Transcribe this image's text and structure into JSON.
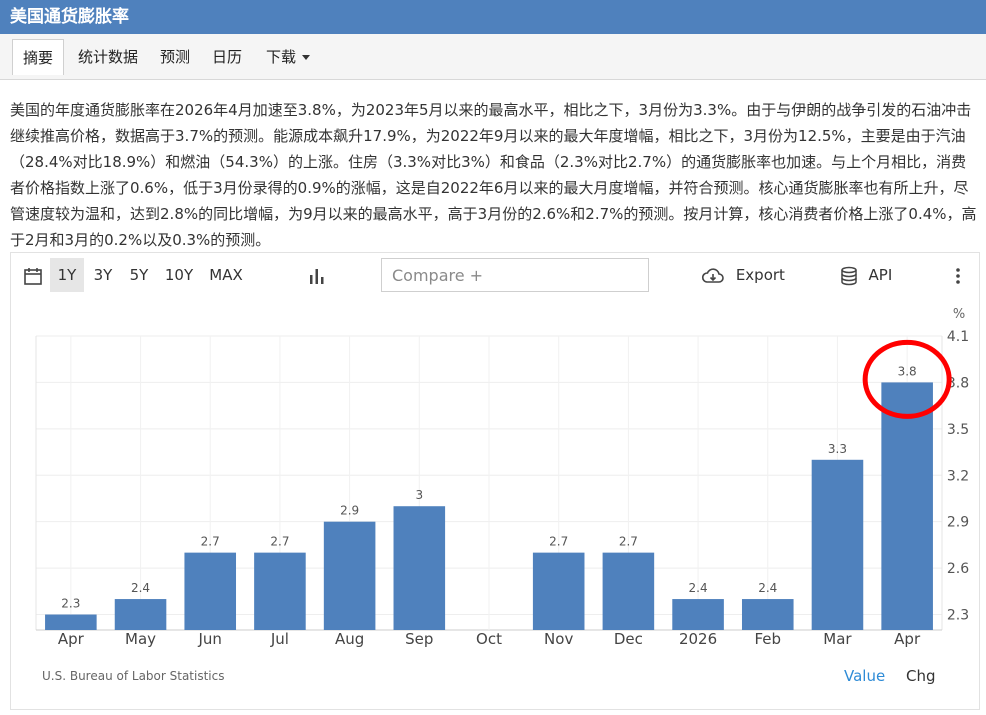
{
  "page": {
    "title": "美国通货膨胀率",
    "tabs": [
      {
        "label": "摘要"
      },
      {
        "label": "统计数据"
      },
      {
        "label": "预测"
      },
      {
        "label": "日历"
      },
      {
        "label": "下载"
      }
    ],
    "description": "美国的年度通货膨胀率在2026年4月加速至3.8%，为2023年5月以来的最高水平，相比之下，3月份为3.3%。由于与伊朗的战争引发的石油冲击继续推高价格，数据高于3.7%的预测。能源成本飙升17.9%，为2022年9月以来的最大年度增幅，相比之下，3月份为12.5%，主要是由于汽油（28.4%对比18.9%）和燃油（54.3%）的上涨。住房（3.3%对比3%）和食品（2.3%对比2.7%）的通货膨胀率也加速。与上个月相比，消费者价格指数上涨了0.6%，低于3月份录得的0.9%的涨幅，这是自2022年6月以来的最大月度增幅，并符合预测。核心通货膨胀率也有所上升，尽管速度较为温和，达到2.8%的同比增幅，为9月以来的最高水平，高于3月份的2.6%和2.7%的预测。按月计算，核心消费者价格上涨了0.4%，高于2月和3月的0.2%以及0.3%的预测。"
  },
  "toolbar": {
    "ranges": [
      "1Y",
      "3Y",
      "5Y",
      "10Y",
      "MAX"
    ],
    "selected_range": "1Y",
    "compare_placeholder": "Compare +",
    "export_label": "Export",
    "api_label": "API",
    "icons": [
      "calendar-icon",
      "bar-chart-icon",
      "cloud-download-icon",
      "database-icon",
      "more-vertical-icon"
    ]
  },
  "chart_data": {
    "type": "bar",
    "categories": [
      "Apr",
      "May",
      "Jun",
      "Jul",
      "Aug",
      "Sep",
      "Oct",
      "Nov",
      "Dec",
      "2026",
      "Feb",
      "Mar",
      "Apr"
    ],
    "values": [
      2.3,
      2.4,
      2.7,
      2.7,
      2.9,
      3,
      null,
      2.7,
      2.7,
      2.4,
      2.4,
      3.3,
      3.8
    ],
    "data_labels": [
      "2.3",
      "2.4",
      "2.7",
      "2.7",
      "2.9",
      "3",
      "",
      "2.7",
      "2.7",
      "2.4",
      "2.4",
      "3.3",
      "3.8"
    ],
    "y_unit": "%",
    "y_ticks": [
      "4.1",
      "3.8",
      "3.5",
      "3.2",
      "2.9",
      "2.6",
      "2.3"
    ],
    "ylim": [
      2.2,
      4.1
    ],
    "grid": true,
    "bar_color": "#4f81bd",
    "highlight_color": "#ff0000",
    "highlighted_category_index": 12
  },
  "footer": {
    "source": "U.S. Bureau of Labor Statistics",
    "value_label": "Value",
    "chg_label": "Chg",
    "value_color": "#2e8bd6"
  }
}
